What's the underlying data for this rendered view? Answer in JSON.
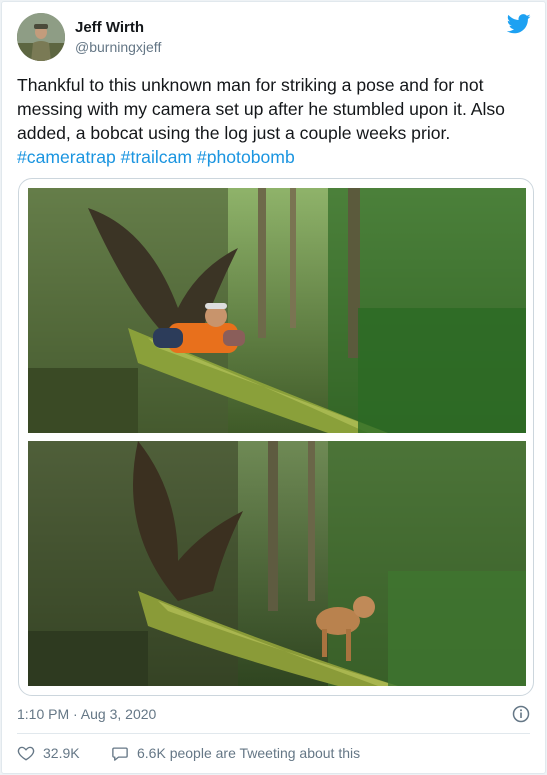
{
  "author": {
    "name": "Jeff Wirth",
    "handle": "@burningxjeff"
  },
  "tweet": {
    "text": "Thankful to this unknown man for striking a pose and for not messing with my camera set up after he stumbled upon it. Also added, a bobcat using the log just a couple weeks prior.",
    "hashtags": "#cameratrap #trailcam #photobomb"
  },
  "media": {
    "photo_1_alt": "Man in orange vest lying on a mossy fallen log in a forest",
    "photo_2_alt": "Bobcat walking on the same mossy fallen log"
  },
  "meta": {
    "timestamp": "1:10 PM · Aug 3, 2020",
    "likes": "32.9K",
    "conversation": "6.6K people are Tweeting about this"
  },
  "colors": {
    "brand": "#1da1f2",
    "link": "#1b95e0",
    "muted": "#657786",
    "text": "#14171a",
    "border": "#e1e8ed"
  },
  "icons": {
    "brand": "twitter-bird-icon",
    "info": "info-icon",
    "like": "heart-icon",
    "conversation": "speech-bubble-icon"
  }
}
